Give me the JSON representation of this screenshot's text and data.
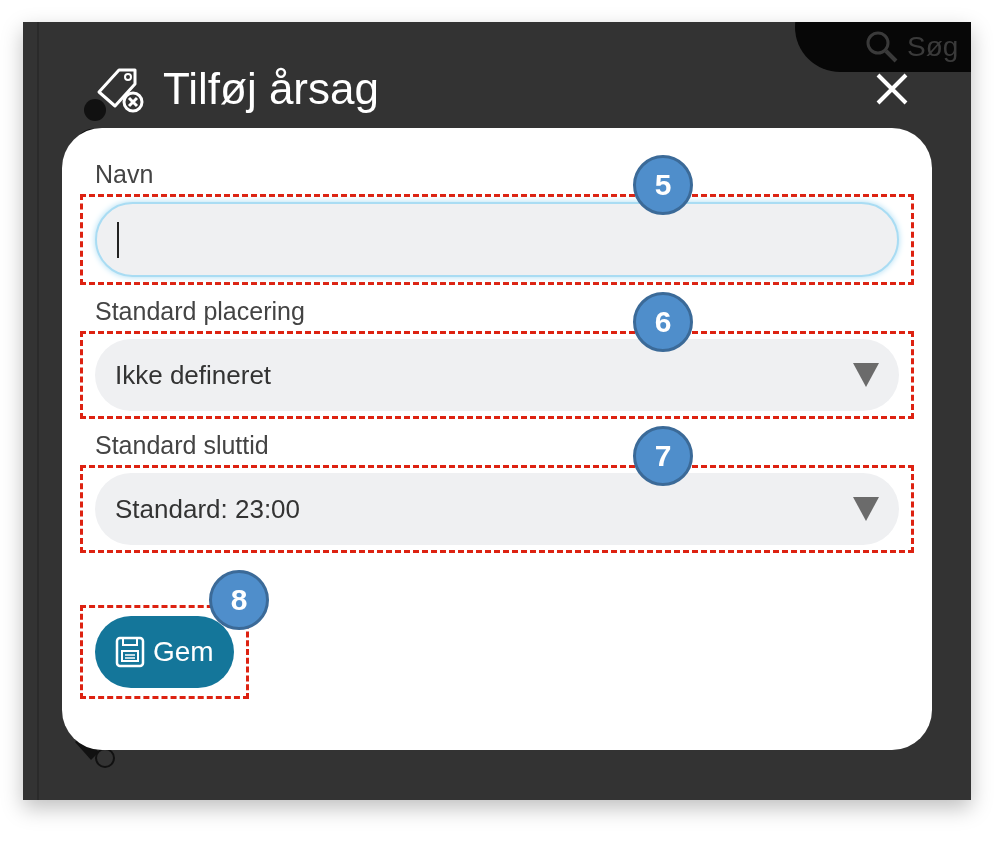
{
  "background": {
    "search_label": "Søg"
  },
  "dialog": {
    "title": "Tilføj årsag",
    "fields": [
      {
        "kind": "text",
        "label": "Navn",
        "focused": true,
        "annotation": "5"
      },
      {
        "kind": "select",
        "label": "Standard placering",
        "value": "Ikke defineret",
        "annotation": "6"
      },
      {
        "kind": "select",
        "label": "Standard sluttid",
        "value": "Standard: 23:00",
        "annotation": "7"
      }
    ],
    "save_button": {
      "label": "Gem",
      "annotation": "8"
    }
  }
}
